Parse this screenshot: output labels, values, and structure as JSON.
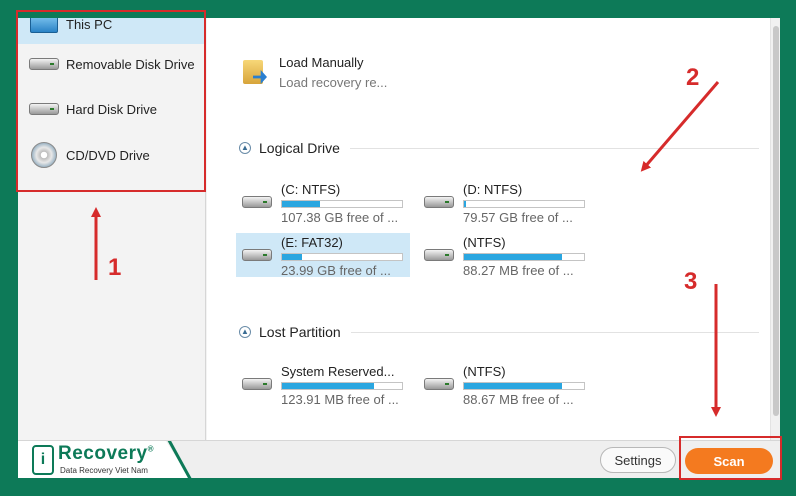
{
  "sidebar": {
    "items": [
      {
        "label": "This PC",
        "icon": "computer-icon",
        "selected": true
      },
      {
        "label": "Removable Disk Drive",
        "icon": "removable-drive-icon"
      },
      {
        "label": "Hard Disk Drive",
        "icon": "hard-disk-icon"
      },
      {
        "label": "CD/DVD Drive",
        "icon": "cd-dvd-icon"
      }
    ]
  },
  "load_manually": {
    "title": "Load Manually",
    "subtitle": "Load recovery re..."
  },
  "logical_drive": {
    "title": "Logical Drive",
    "drives": [
      {
        "name": "(C: NTFS)",
        "free": "107.38 GB free of ...",
        "usage": 0.32
      },
      {
        "name": "(D: NTFS)",
        "free": "79.57 GB free of ...",
        "usage": 0.02
      },
      {
        "name": "(E: FAT32)",
        "free": "23.99 GB free of ...",
        "usage": 0.17,
        "selected": true
      },
      {
        "name": "(NTFS)",
        "free": "88.27 MB free of ...",
        "usage": 0.82
      }
    ]
  },
  "lost_partition": {
    "title": "Lost Partition",
    "drives": [
      {
        "name": "System Reserved...",
        "free": "123.91 MB free of ...",
        "usage": 0.77
      },
      {
        "name": "(NTFS)",
        "free": "88.67 MB free of ...",
        "usage": 0.82
      }
    ]
  },
  "footer": {
    "logo_mark": "i",
    "logo_name": "Recovery",
    "logo_reg": "®",
    "logo_tagline": "Data Recovery Viet Nam",
    "settings_label": "Settings",
    "scan_label": "Scan"
  },
  "annotations": {
    "step1": "1",
    "step2": "2",
    "step3": "3",
    "color": "#d62b2b"
  },
  "colors": {
    "brand_green": "#0d7a58",
    "accent_orange": "#f47a1f",
    "usage_blue": "#2aa6e0",
    "selected_bg": "#cfe8f7"
  }
}
